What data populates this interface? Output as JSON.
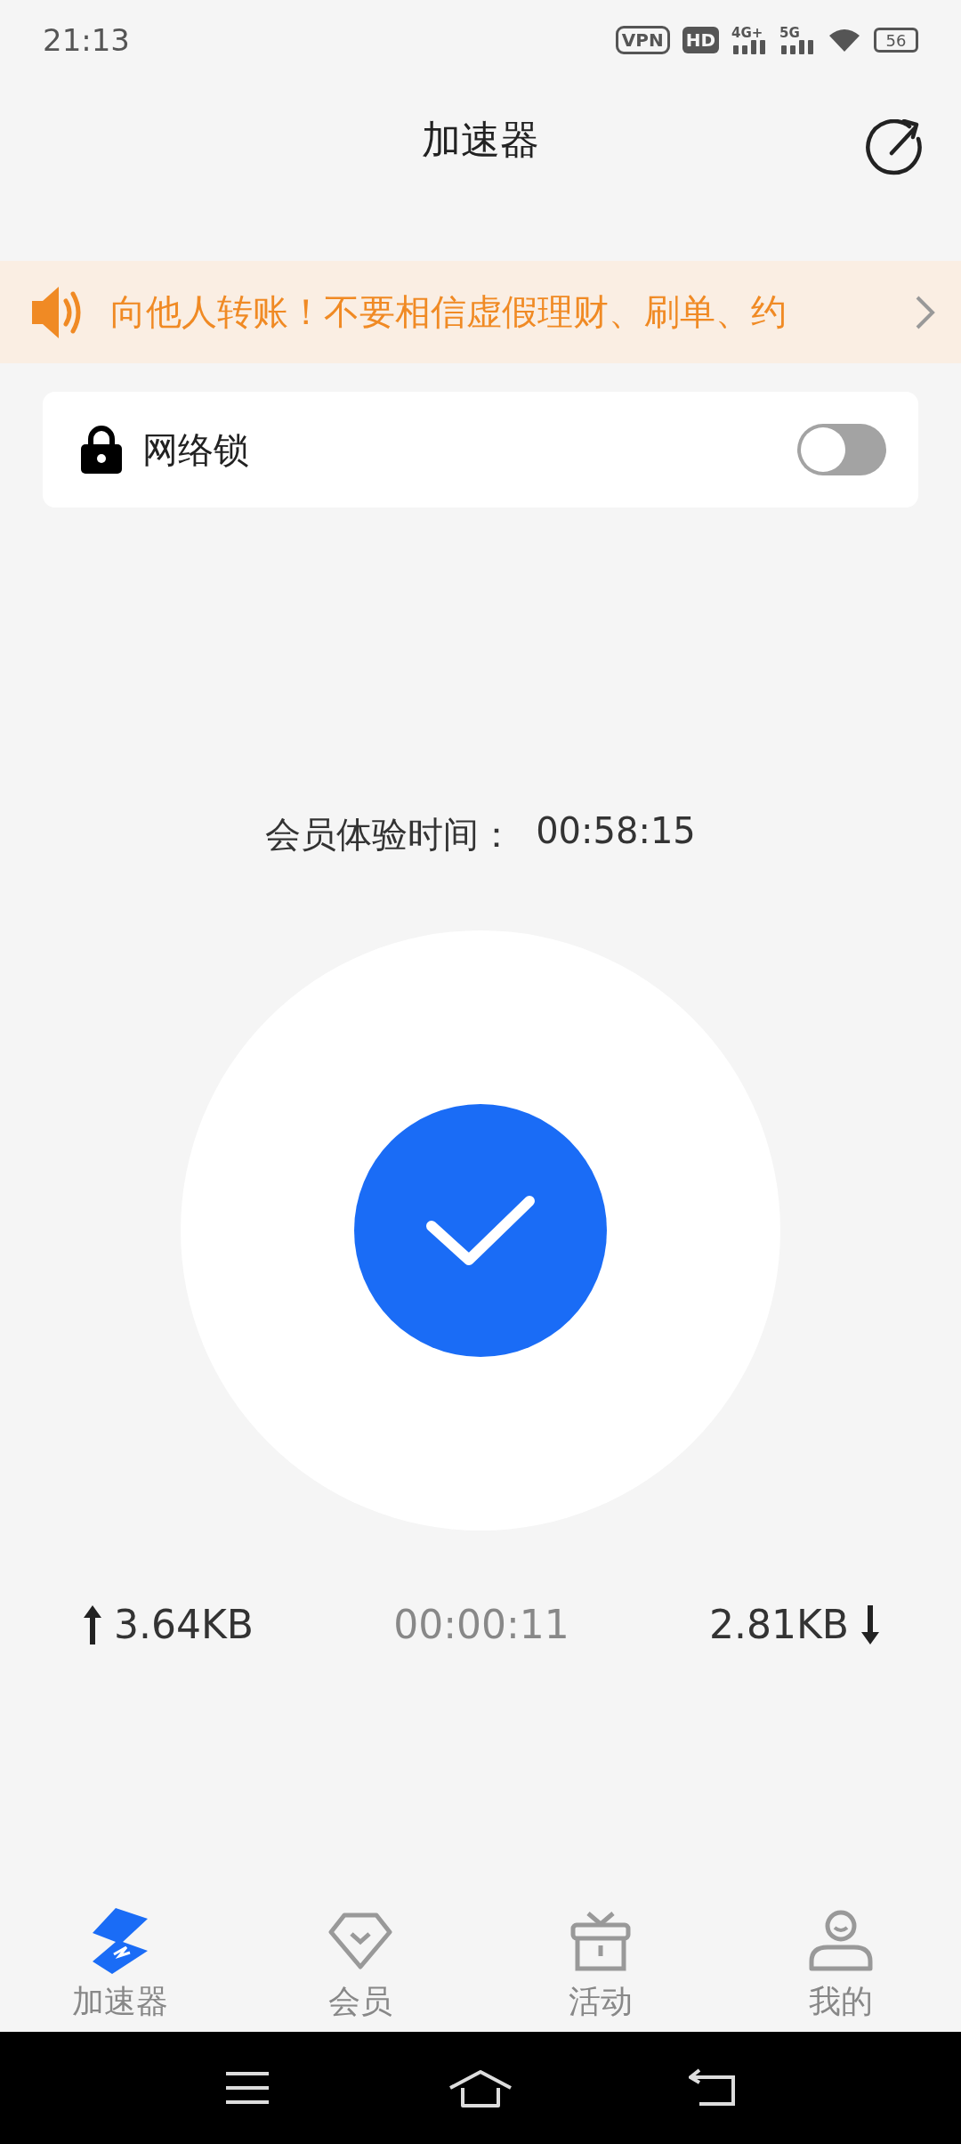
{
  "status_bar": {
    "time": "21:13",
    "vpn": "VPN",
    "hd": "HD",
    "signals": [
      {
        "label": "4G+"
      },
      {
        "label": "5G"
      }
    ],
    "battery": "56"
  },
  "header": {
    "title": "加速器"
  },
  "notice": {
    "text": "向他人转账！不要相信虚假理财、刷单、约"
  },
  "network_lock": {
    "label": "网络锁",
    "on": false
  },
  "trial": {
    "label": "会员体验时间：",
    "time": "00:58:15"
  },
  "connection": {
    "connected": true
  },
  "stats": {
    "upload": "3.64KB",
    "duration": "00:00:11",
    "download": "2.81KB"
  },
  "tabs": [
    {
      "label": "加速器",
      "kind": "bolt",
      "selected": true
    },
    {
      "label": "会员",
      "kind": "diamond",
      "selected": false
    },
    {
      "label": "活动",
      "kind": "gift",
      "selected": false
    },
    {
      "label": "我的",
      "kind": "user",
      "selected": false
    }
  ]
}
